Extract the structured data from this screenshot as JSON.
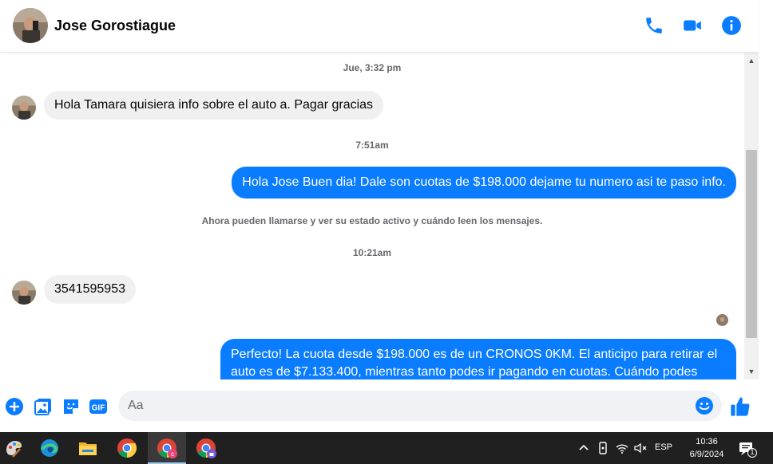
{
  "header": {
    "contact_name": "Jose Gorostiague",
    "icons": [
      "phone-icon",
      "video-camera-icon",
      "info-icon"
    ],
    "accent_color": "#0a7cff"
  },
  "thread": {
    "items": [
      {
        "type": "timestamp",
        "text": "Jue, 3:32 pm"
      },
      {
        "type": "incoming",
        "text": "Hola Tamara quisiera info sobre el auto a. Pagar gracias"
      },
      {
        "type": "timestamp",
        "text": "7:51am"
      },
      {
        "type": "outgoing",
        "text": "Hola Jose Buen dia! Dale son cuotas de $198.000 dejame tu numero asi te paso info."
      },
      {
        "type": "system",
        "text": "Ahora pueden llamarse y ver su estado activo y cuándo leen los mensajes."
      },
      {
        "type": "timestamp",
        "text": "10:21am"
      },
      {
        "type": "incoming",
        "text": "3541595953"
      },
      {
        "type": "outgoing",
        "text": "Perfecto! La cuota desde $198.000 es de un CRONOS 0KM. El anticipo para retirar el auto es de $7.133.400, mientras tanto podes ir pagando en cuotas. Cuándo podes"
      }
    ]
  },
  "composer": {
    "placeholder": "Aa",
    "icons": [
      "add-circle-icon",
      "photo-icon",
      "sticker-icon",
      "gif-icon",
      "emoji-icon",
      "thumbs-up-icon"
    ],
    "gif_label": "GIF"
  },
  "taskbar": {
    "apps": [
      "paint-app-icon",
      "edge-icon",
      "file-explorer-icon",
      "chrome-icon",
      "chrome-profile-c-icon",
      "chrome-profile-lock-icon"
    ],
    "language": "ESP",
    "time": "10:36",
    "date": "6/9/2024",
    "notification_count": "1"
  }
}
